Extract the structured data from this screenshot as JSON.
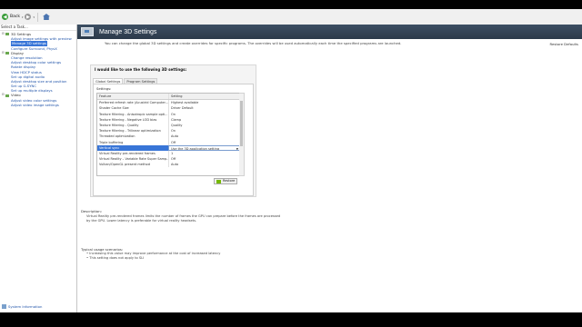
{
  "toolbar": {
    "back_label": "Back",
    "forward_label": "",
    "icons": [
      "back-arrow-icon",
      "forward-arrow-icon",
      "home-icon"
    ]
  },
  "left_pane": {
    "header": "Select a Task...",
    "tree": [
      {
        "label": "3D Settings",
        "level": 0
      },
      {
        "label": "Adjust image settings with preview",
        "level": 1
      },
      {
        "label": "Manage 3D settings",
        "level": 1,
        "selected": true
      },
      {
        "label": "Configure Surround, PhysX",
        "level": 1
      },
      {
        "label": "Display",
        "level": 0
      },
      {
        "label": "Change resolution",
        "level": 1
      },
      {
        "label": "Adjust desktop color settings",
        "level": 1
      },
      {
        "label": "Rotate display",
        "level": 1
      },
      {
        "label": "View HDCP status",
        "level": 1
      },
      {
        "label": "Set up digital audio",
        "level": 1
      },
      {
        "label": "Adjust desktop size and position",
        "level": 1
      },
      {
        "label": "Set up G-SYNC",
        "level": 1
      },
      {
        "label": "Set up multiple displays",
        "level": 1
      },
      {
        "label": "Video",
        "level": 0
      },
      {
        "label": "Adjust video color settings",
        "level": 1
      },
      {
        "label": "Adjust video image settings",
        "level": 1
      }
    ],
    "system_info": "System Information"
  },
  "banner": {
    "title": "Manage 3D Settings"
  },
  "description_line": "You can change the global 3D settings and create overrides for specific programs. The overrides will be used automatically each time the specified programs are launched.",
  "restore_defaults": "Restore Defaults",
  "panel": {
    "title": "I would like to use the following 3D settings:",
    "tabs": [
      {
        "label": "Global Settings",
        "active": true
      },
      {
        "label": "Program Settings",
        "active": false
      }
    ],
    "settings_label": "Settings:",
    "columns": [
      "Feature",
      "Setting"
    ],
    "rows": [
      {
        "feature": "Preferred refresh rate (Acustrid Computer...",
        "setting": "Highest available"
      },
      {
        "feature": "Shader Cache Size",
        "setting": "Driver Default"
      },
      {
        "feature": "Texture filtering - Anisotropic sample opti...",
        "setting": "On"
      },
      {
        "feature": "Texture filtering - Negative LOD bias",
        "setting": "Clamp"
      },
      {
        "feature": "Texture filtering - Quality",
        "setting": "Quality"
      },
      {
        "feature": "Texture filtering - Trilinear optimization",
        "setting": "On"
      },
      {
        "feature": "Threaded optimization",
        "setting": "Auto"
      },
      {
        "feature": "Triple buffering",
        "setting": "Off"
      },
      {
        "feature": "Vertical sync",
        "setting": "Use the 3D application setting",
        "selected": true
      },
      {
        "feature": "Virtual Reality pre-rendered frames",
        "setting": "1"
      },
      {
        "feature": "Virtual Reality – Variable Rate Super Samp...",
        "setting": "Off"
      },
      {
        "feature": "Vulkan/OpenGL present method",
        "setting": "Auto"
      }
    ],
    "restore_button": "Restore"
  },
  "description": {
    "heading": "Description:",
    "text": "Virtual Reality pre-rendered frames limits the number of frames the GPU can prepare before the frames are processed by the GPU. Lower latency is preferable for virtual reality headsets."
  },
  "usage": {
    "heading": "Typical usage scenarios:",
    "items": [
      "Increasing this value may improve performance at the cost of increased latency",
      "This setting does not apply to SLI"
    ]
  }
}
